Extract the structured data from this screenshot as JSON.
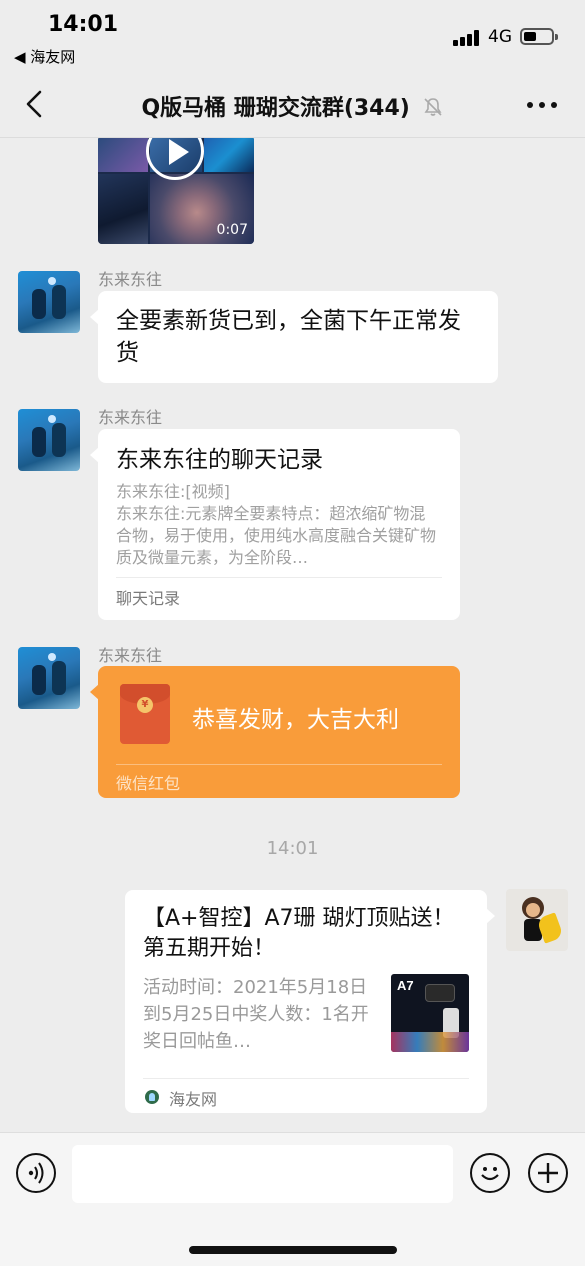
{
  "status_bar": {
    "time": "14:01",
    "back_app": "◀ 海友网",
    "network": "4G"
  },
  "header": {
    "title": "Q版马桶 珊瑚交流群(344)"
  },
  "chat": {
    "video": {
      "duration": "0:07"
    },
    "messages": [
      {
        "sender": "东来东往",
        "text": "全要素新货已到，全菌下午正常发货"
      },
      {
        "sender": "东来东往",
        "card": {
          "title": "东来东往的聊天记录",
          "line1": "东来东往:[视频]",
          "line2": "东来东往:元素牌全要素特点：超浓缩矿物混合物，易于使用，使用纯水高度融合关键矿物质及微量元素，为全阶段…",
          "footer": "聊天记录"
        }
      },
      {
        "sender": "东来东往",
        "red_packet": {
          "title": "恭喜发财，大吉大利",
          "label": "微信红包"
        }
      }
    ],
    "timestamp": "14:01",
    "link_card": {
      "title": "【A+智控】A7珊 瑚灯顶贴送！第五期开始！",
      "desc": "活动时间：2021年5月18日到5月25日中奖人数：1名开奖日回帖鱼…",
      "thumb_text": "A7",
      "source": "海友网"
    }
  },
  "colors": {
    "background": "#ededed",
    "red_packet": "#f99c3a",
    "bubble": "#ffffff"
  }
}
